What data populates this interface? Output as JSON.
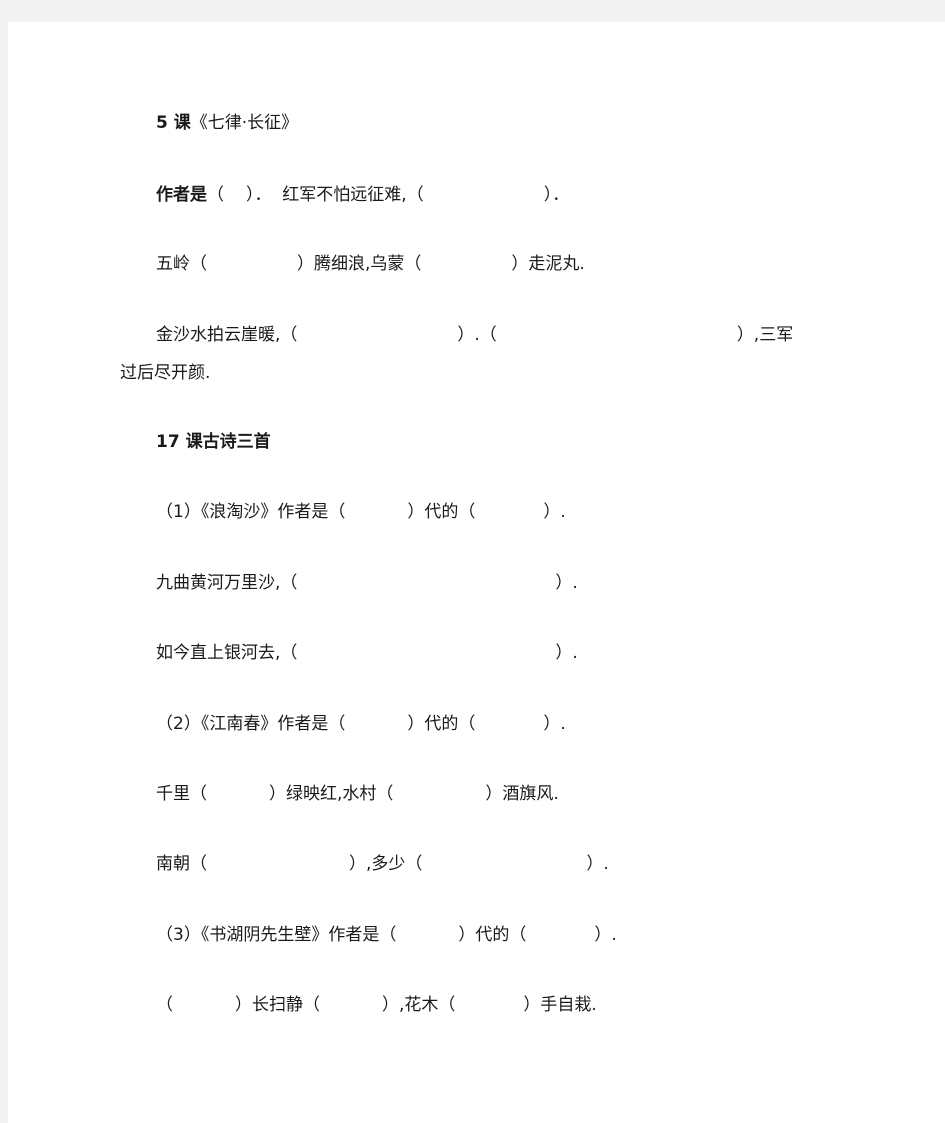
{
  "document": {
    "sections": [
      {
        "heading_number": "5 课",
        "heading_title": "《七律·长征》",
        "lines": [
          {
            "author_label": "作者是",
            "segments": [
              "（",
              "）．  红军不怕远征难,（",
              "）．"
            ]
          },
          {
            "segments": [
              "五岭（",
              "）腾细浪,乌蒙（",
              "）走泥丸."
            ]
          },
          {
            "segments": [
              "金沙水拍云崖暖,（",
              "）.（",
              "）,三军"
            ],
            "continuation": "过后尽开颜."
          }
        ]
      },
      {
        "heading": "17 课古诗三首",
        "lines": [
          {
            "segments": [
              "（1）《浪淘沙》作者是（",
              "）代的（",
              "）."
            ]
          },
          {
            "segments": [
              "九曲黄河万里沙,（",
              "）."
            ]
          },
          {
            "segments": [
              "如今直上银河去,（",
              "）."
            ]
          },
          {
            "segments": [
              "（2）《江南春》作者是（",
              "）代的（",
              "）."
            ]
          },
          {
            "segments": [
              "千里（",
              "）绿映红,水村（",
              "）酒旗风."
            ]
          },
          {
            "segments": [
              "南朝（",
              "）,多少（",
              "）."
            ]
          },
          {
            "segments": [
              "（3）《书湖阴先生壁》作者是（",
              "）代的（",
              "）."
            ]
          },
          {
            "segments": [
              "（",
              "）长扫静（",
              "）,花木（",
              "）手自栽."
            ]
          }
        ]
      }
    ]
  }
}
